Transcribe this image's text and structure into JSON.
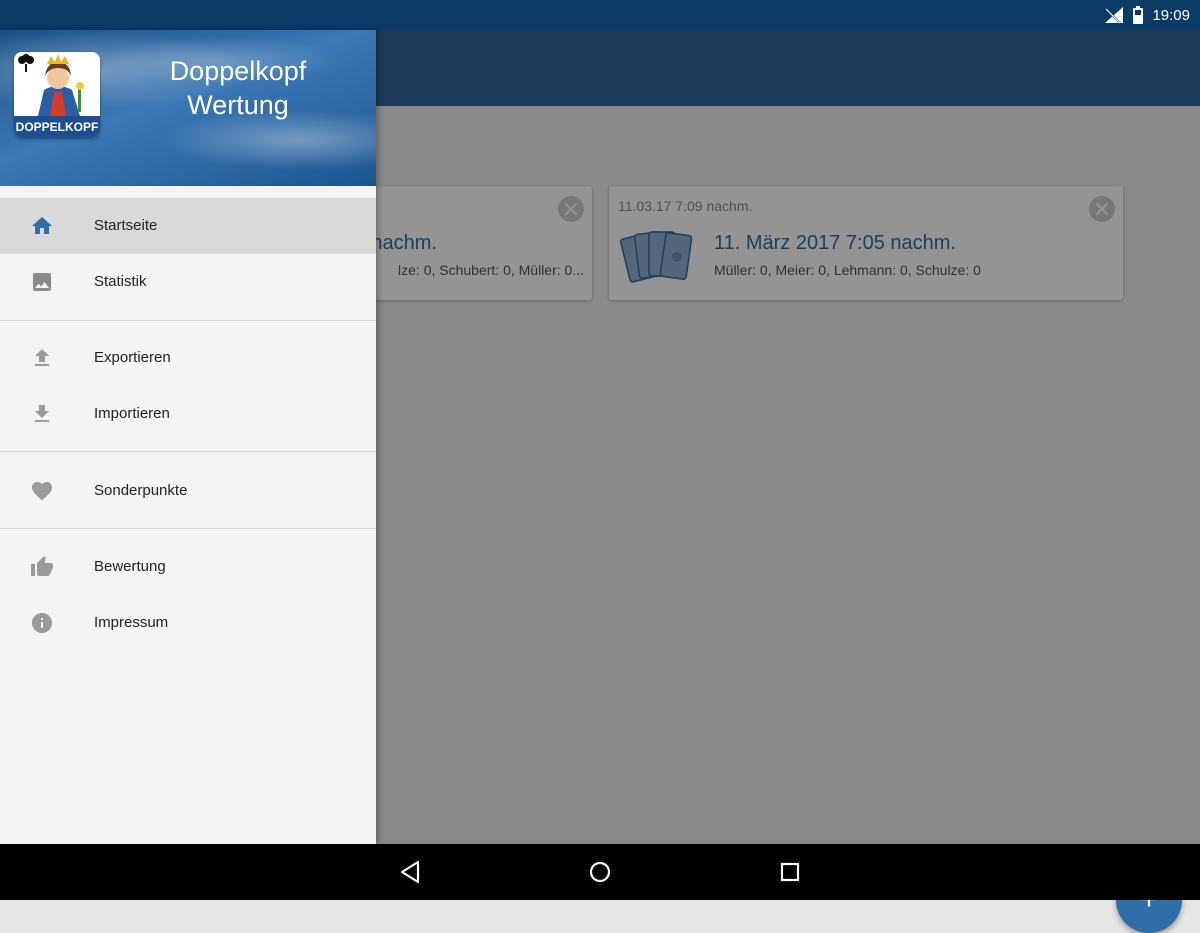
{
  "status_bar": {
    "time": "19:09"
  },
  "drawer": {
    "app_name_line1": "Doppelkopf",
    "app_name_line2": "Wertung",
    "logo_label": "DOPPELKOPF",
    "items": [
      {
        "label": "Startseite",
        "icon": "home-icon",
        "active": true
      },
      {
        "label": "Statistik",
        "icon": "image-icon"
      },
      {
        "label": "Exportieren",
        "icon": "upload-icon"
      },
      {
        "label": "Importieren",
        "icon": "download-icon"
      },
      {
        "label": "Sonderpunkte",
        "icon": "heart-icon"
      },
      {
        "label": "Bewertung",
        "icon": "thumbs-up-icon"
      },
      {
        "label": "Impressum",
        "icon": "info-icon"
      }
    ]
  },
  "games": [
    {
      "title": "nachm.",
      "players": "lze: 0, Schubert: 0, Müller: 0..."
    },
    {
      "stamp": "11.03.17 7:09 nachm.",
      "title": "11. März 2017 7:05 nachm.",
      "players": "Müller: 0, Meier: 0, Lehmann: 0, Schulze: 0"
    }
  ],
  "fab": {
    "label": "+"
  },
  "colors": {
    "primary": "#336699",
    "status_bar": "#0a3a66",
    "accent": "#2f6ea8",
    "drawer_bg": "#f4f4f4"
  }
}
